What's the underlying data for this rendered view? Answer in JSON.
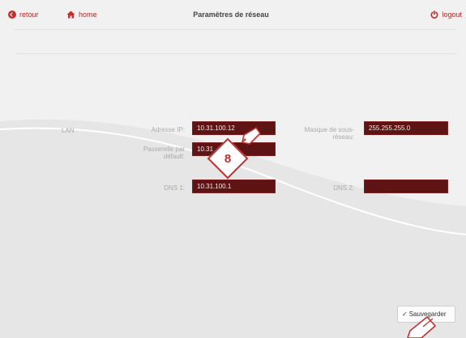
{
  "nav": {
    "back_label": "retour",
    "home_label": "home",
    "logout_label": "logout",
    "title": "Paramètres de réseau"
  },
  "form": {
    "section_label": "LAN",
    "ip": {
      "label": "Adresse IP:",
      "value": "10.31.100.12"
    },
    "mask": {
      "label_line1": "Masque de sous-",
      "label_line2": "réseau:",
      "value": "255.255.255.0"
    },
    "gateway": {
      "label_line1": "Passerelle par",
      "label_line2": "défault:",
      "value": "10.31"
    },
    "dns1": {
      "label": "DNS 1:",
      "value": "10.31.100.1"
    },
    "dns2": {
      "label": "DNS 2:",
      "value": ""
    }
  },
  "actions": {
    "save_label": "Sauvegarder",
    "save_icon": "check-icon"
  },
  "annotation": {
    "step_number": "8"
  },
  "colors": {
    "accent": "#c22f2f",
    "field_bg": "#5e1414",
    "background": "#f1f1f1"
  }
}
